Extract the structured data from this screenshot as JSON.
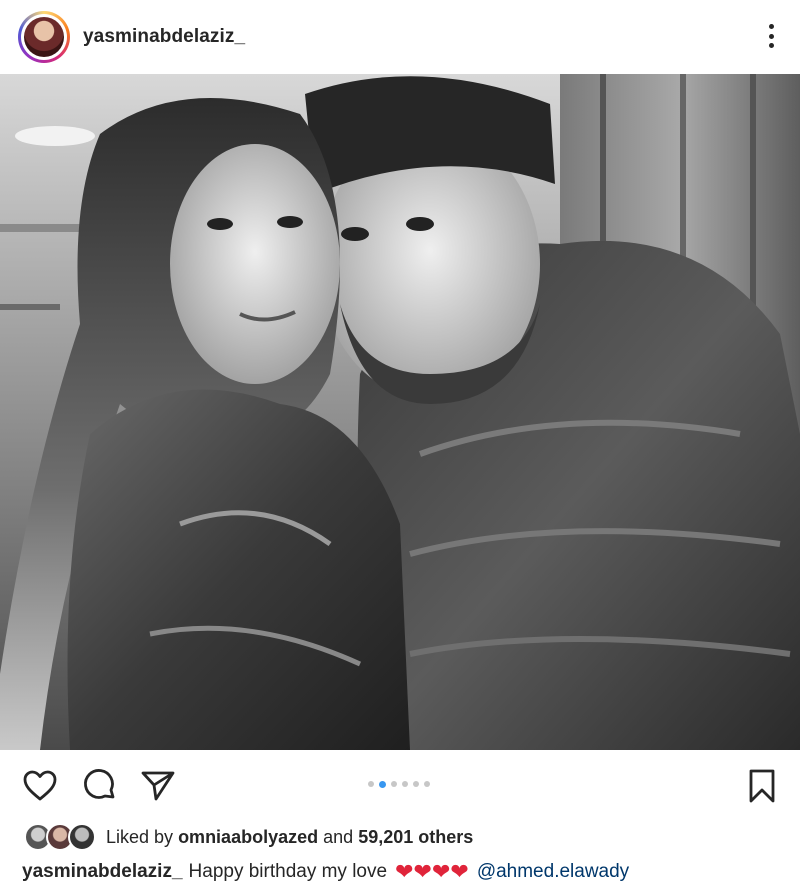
{
  "post": {
    "username": "yasminabdelaziz_",
    "photo_alt": "Black and white photo of a couple",
    "carousel": {
      "count": 6,
      "active_index": 1
    },
    "likes": {
      "prefix": "Liked by",
      "user": "omniaabolyazed",
      "middle": "and",
      "count": "59,201 others"
    },
    "caption": {
      "user": "yasminabdelaziz_",
      "text": "Happy birthday my love",
      "hearts": "❤❤❤❤",
      "mention": "@ahmed.elawady"
    }
  },
  "icons": {
    "menu": "more-vertical-icon",
    "like": "heart-icon",
    "comment": "comment-bubble-icon",
    "share": "paper-plane-icon",
    "save": "bookmark-icon"
  },
  "colors": {
    "text": "#262626",
    "carousel_active": "#3897f0",
    "carousel_inactive": "#c7c7c7",
    "heart_emoji": "#e0243a",
    "mention": "#00376b"
  }
}
